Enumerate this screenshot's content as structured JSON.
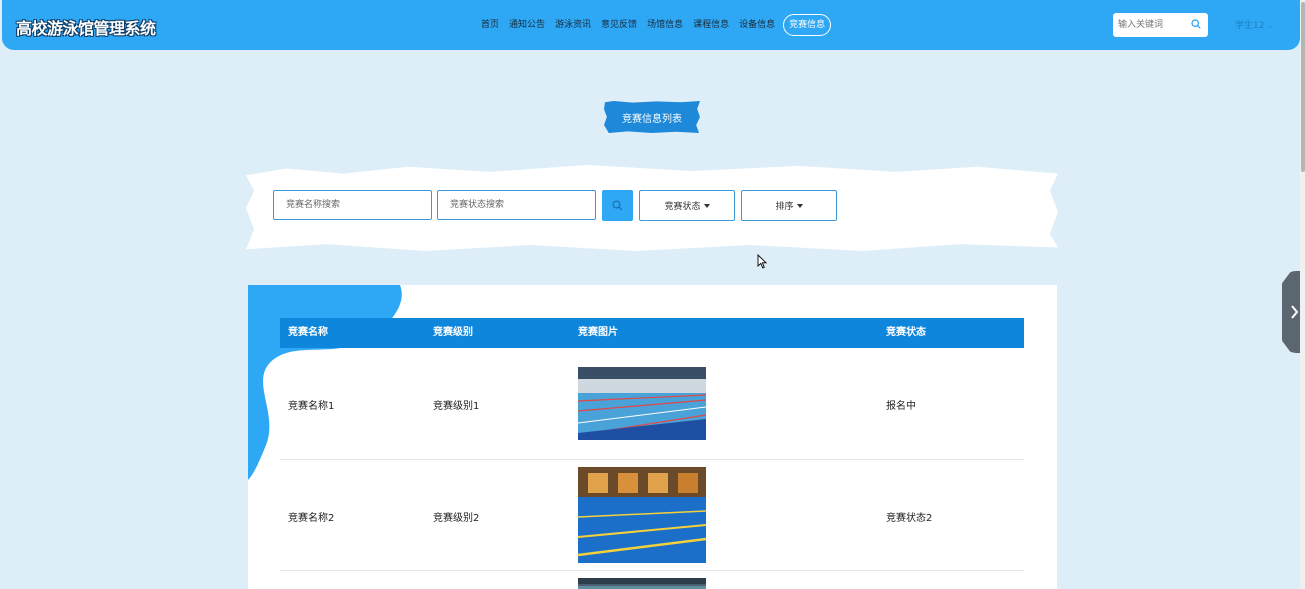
{
  "header": {
    "title": "高校游泳馆管理系统",
    "nav": [
      "首页",
      "通知公告",
      "游泳资讯",
      "意见反馈",
      "场馆信息",
      "课程信息",
      "设备信息"
    ],
    "nav_active": "竞赛信息",
    "search_placeholder": "输入关键词",
    "user": "学生12"
  },
  "page": {
    "banner": "竞赛信息列表"
  },
  "filters": {
    "name_placeholder": "竞赛名称搜索",
    "status_placeholder": "竞赛状态搜索",
    "status_dropdown": "竞赛状态",
    "sort_dropdown": "排序"
  },
  "table": {
    "columns": [
      "竞赛名称",
      "竞赛级别",
      "竞赛图片",
      "竞赛状态"
    ],
    "rows": [
      {
        "name": "竞赛名称1",
        "level": "竞赛级别1",
        "status": "报名中"
      },
      {
        "name": "竞赛名称2",
        "level": "竞赛级别2",
        "status": "竞赛状态2"
      }
    ]
  },
  "colors": {
    "header_bg": "#2ea8f5",
    "page_bg": "#ddeef9",
    "table_head_bg": "#0e86dc"
  },
  "icons": {
    "search": "search-icon",
    "caret": "chevron-down-icon",
    "side_tab": "chevron-right-icon"
  }
}
